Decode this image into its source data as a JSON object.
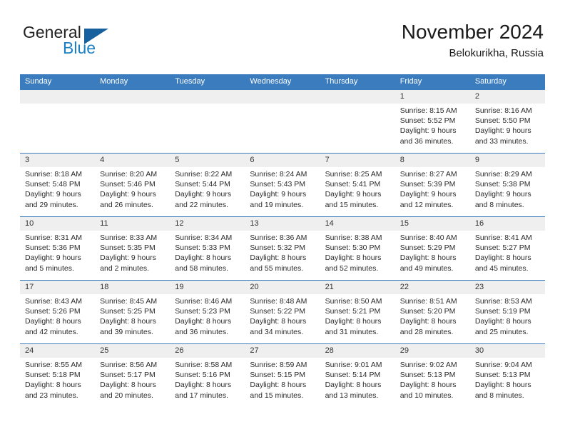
{
  "brand": {
    "name_top": "General",
    "name_bottom": "Blue",
    "accent_color": "#1b7fc4",
    "triangle_color": "#16609e"
  },
  "header": {
    "title": "November 2024",
    "subtitle": "Belokurikha, Russia"
  },
  "theme": {
    "header_bg": "#3a7cbe",
    "daynum_bg": "#efefef",
    "row_border": "#3a7cbe"
  },
  "weekdays": [
    "Sunday",
    "Monday",
    "Tuesday",
    "Wednesday",
    "Thursday",
    "Friday",
    "Saturday"
  ],
  "weeks": [
    [
      {
        "day": "",
        "empty": true
      },
      {
        "day": "",
        "empty": true
      },
      {
        "day": "",
        "empty": true
      },
      {
        "day": "",
        "empty": true
      },
      {
        "day": "",
        "empty": true
      },
      {
        "day": "1",
        "sunrise": "Sunrise: 8:15 AM",
        "sunset": "Sunset: 5:52 PM",
        "daylight1": "Daylight: 9 hours",
        "daylight2": "and 36 minutes."
      },
      {
        "day": "2",
        "sunrise": "Sunrise: 8:16 AM",
        "sunset": "Sunset: 5:50 PM",
        "daylight1": "Daylight: 9 hours",
        "daylight2": "and 33 minutes."
      }
    ],
    [
      {
        "day": "3",
        "sunrise": "Sunrise: 8:18 AM",
        "sunset": "Sunset: 5:48 PM",
        "daylight1": "Daylight: 9 hours",
        "daylight2": "and 29 minutes."
      },
      {
        "day": "4",
        "sunrise": "Sunrise: 8:20 AM",
        "sunset": "Sunset: 5:46 PM",
        "daylight1": "Daylight: 9 hours",
        "daylight2": "and 26 minutes."
      },
      {
        "day": "5",
        "sunrise": "Sunrise: 8:22 AM",
        "sunset": "Sunset: 5:44 PM",
        "daylight1": "Daylight: 9 hours",
        "daylight2": "and 22 minutes."
      },
      {
        "day": "6",
        "sunrise": "Sunrise: 8:24 AM",
        "sunset": "Sunset: 5:43 PM",
        "daylight1": "Daylight: 9 hours",
        "daylight2": "and 19 minutes."
      },
      {
        "day": "7",
        "sunrise": "Sunrise: 8:25 AM",
        "sunset": "Sunset: 5:41 PM",
        "daylight1": "Daylight: 9 hours",
        "daylight2": "and 15 minutes."
      },
      {
        "day": "8",
        "sunrise": "Sunrise: 8:27 AM",
        "sunset": "Sunset: 5:39 PM",
        "daylight1": "Daylight: 9 hours",
        "daylight2": "and 12 minutes."
      },
      {
        "day": "9",
        "sunrise": "Sunrise: 8:29 AM",
        "sunset": "Sunset: 5:38 PM",
        "daylight1": "Daylight: 9 hours",
        "daylight2": "and 8 minutes."
      }
    ],
    [
      {
        "day": "10",
        "sunrise": "Sunrise: 8:31 AM",
        "sunset": "Sunset: 5:36 PM",
        "daylight1": "Daylight: 9 hours",
        "daylight2": "and 5 minutes."
      },
      {
        "day": "11",
        "sunrise": "Sunrise: 8:33 AM",
        "sunset": "Sunset: 5:35 PM",
        "daylight1": "Daylight: 9 hours",
        "daylight2": "and 2 minutes."
      },
      {
        "day": "12",
        "sunrise": "Sunrise: 8:34 AM",
        "sunset": "Sunset: 5:33 PM",
        "daylight1": "Daylight: 8 hours",
        "daylight2": "and 58 minutes."
      },
      {
        "day": "13",
        "sunrise": "Sunrise: 8:36 AM",
        "sunset": "Sunset: 5:32 PM",
        "daylight1": "Daylight: 8 hours",
        "daylight2": "and 55 minutes."
      },
      {
        "day": "14",
        "sunrise": "Sunrise: 8:38 AM",
        "sunset": "Sunset: 5:30 PM",
        "daylight1": "Daylight: 8 hours",
        "daylight2": "and 52 minutes."
      },
      {
        "day": "15",
        "sunrise": "Sunrise: 8:40 AM",
        "sunset": "Sunset: 5:29 PM",
        "daylight1": "Daylight: 8 hours",
        "daylight2": "and 49 minutes."
      },
      {
        "day": "16",
        "sunrise": "Sunrise: 8:41 AM",
        "sunset": "Sunset: 5:27 PM",
        "daylight1": "Daylight: 8 hours",
        "daylight2": "and 45 minutes."
      }
    ],
    [
      {
        "day": "17",
        "sunrise": "Sunrise: 8:43 AM",
        "sunset": "Sunset: 5:26 PM",
        "daylight1": "Daylight: 8 hours",
        "daylight2": "and 42 minutes."
      },
      {
        "day": "18",
        "sunrise": "Sunrise: 8:45 AM",
        "sunset": "Sunset: 5:25 PM",
        "daylight1": "Daylight: 8 hours",
        "daylight2": "and 39 minutes."
      },
      {
        "day": "19",
        "sunrise": "Sunrise: 8:46 AM",
        "sunset": "Sunset: 5:23 PM",
        "daylight1": "Daylight: 8 hours",
        "daylight2": "and 36 minutes."
      },
      {
        "day": "20",
        "sunrise": "Sunrise: 8:48 AM",
        "sunset": "Sunset: 5:22 PM",
        "daylight1": "Daylight: 8 hours",
        "daylight2": "and 34 minutes."
      },
      {
        "day": "21",
        "sunrise": "Sunrise: 8:50 AM",
        "sunset": "Sunset: 5:21 PM",
        "daylight1": "Daylight: 8 hours",
        "daylight2": "and 31 minutes."
      },
      {
        "day": "22",
        "sunrise": "Sunrise: 8:51 AM",
        "sunset": "Sunset: 5:20 PM",
        "daylight1": "Daylight: 8 hours",
        "daylight2": "and 28 minutes."
      },
      {
        "day": "23",
        "sunrise": "Sunrise: 8:53 AM",
        "sunset": "Sunset: 5:19 PM",
        "daylight1": "Daylight: 8 hours",
        "daylight2": "and 25 minutes."
      }
    ],
    [
      {
        "day": "24",
        "sunrise": "Sunrise: 8:55 AM",
        "sunset": "Sunset: 5:18 PM",
        "daylight1": "Daylight: 8 hours",
        "daylight2": "and 23 minutes."
      },
      {
        "day": "25",
        "sunrise": "Sunrise: 8:56 AM",
        "sunset": "Sunset: 5:17 PM",
        "daylight1": "Daylight: 8 hours",
        "daylight2": "and 20 minutes."
      },
      {
        "day": "26",
        "sunrise": "Sunrise: 8:58 AM",
        "sunset": "Sunset: 5:16 PM",
        "daylight1": "Daylight: 8 hours",
        "daylight2": "and 17 minutes."
      },
      {
        "day": "27",
        "sunrise": "Sunrise: 8:59 AM",
        "sunset": "Sunset: 5:15 PM",
        "daylight1": "Daylight: 8 hours",
        "daylight2": "and 15 minutes."
      },
      {
        "day": "28",
        "sunrise": "Sunrise: 9:01 AM",
        "sunset": "Sunset: 5:14 PM",
        "daylight1": "Daylight: 8 hours",
        "daylight2": "and 13 minutes."
      },
      {
        "day": "29",
        "sunrise": "Sunrise: 9:02 AM",
        "sunset": "Sunset: 5:13 PM",
        "daylight1": "Daylight: 8 hours",
        "daylight2": "and 10 minutes."
      },
      {
        "day": "30",
        "sunrise": "Sunrise: 9:04 AM",
        "sunset": "Sunset: 5:13 PM",
        "daylight1": "Daylight: 8 hours",
        "daylight2": "and 8 minutes."
      }
    ]
  ]
}
